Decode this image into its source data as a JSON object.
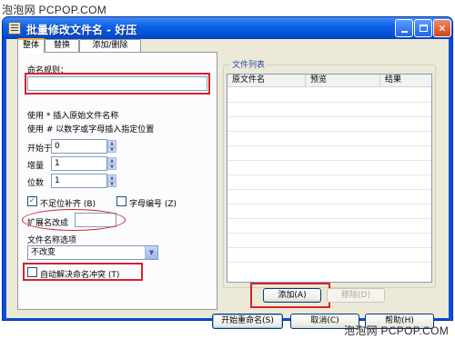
{
  "watermark": {
    "top": "泡泡网 PCPOP.COM",
    "bottom": "泡泡网 PCPOP.COM"
  },
  "window": {
    "title": "批量修改文件名 - 好压"
  },
  "tabs": [
    {
      "label": "整体"
    },
    {
      "label": "替换"
    },
    {
      "label": "添加/删除"
    }
  ],
  "rule": {
    "label": "命名规则：",
    "value": "",
    "hint1": "使用 * 插入原始文件名称",
    "hint2": "使用 # 以数字或字母插入指定位置"
  },
  "start": {
    "label": "开始于",
    "value": "0"
  },
  "increment": {
    "label": "增量",
    "value": "1"
  },
  "digits": {
    "label": "位数",
    "value": "1"
  },
  "pad_zero": {
    "label": "不足位补齐 (B)",
    "checked": true
  },
  "letter_number": {
    "label": "字母编号 (Z)",
    "checked": false
  },
  "extension": {
    "label": "扩展名改成",
    "value": ""
  },
  "name_option": {
    "label": "文件名称选项",
    "selected": "不改变"
  },
  "auto_resolve": {
    "label": "自动解决命名冲突 (T)",
    "checked": false
  },
  "file_list": {
    "title": "文件列表",
    "columns": [
      "原文件名",
      "预览",
      "结果"
    ]
  },
  "buttons": {
    "add": "添加(A)",
    "remove": "移除(D)",
    "start_rename": "开始重命名(S)",
    "cancel": "取消(C)",
    "help": "帮助(H)"
  },
  "colors": {
    "titlebar": "#0a5ee6",
    "highlight": "#d8202a",
    "dialog": "#ece9d8"
  }
}
